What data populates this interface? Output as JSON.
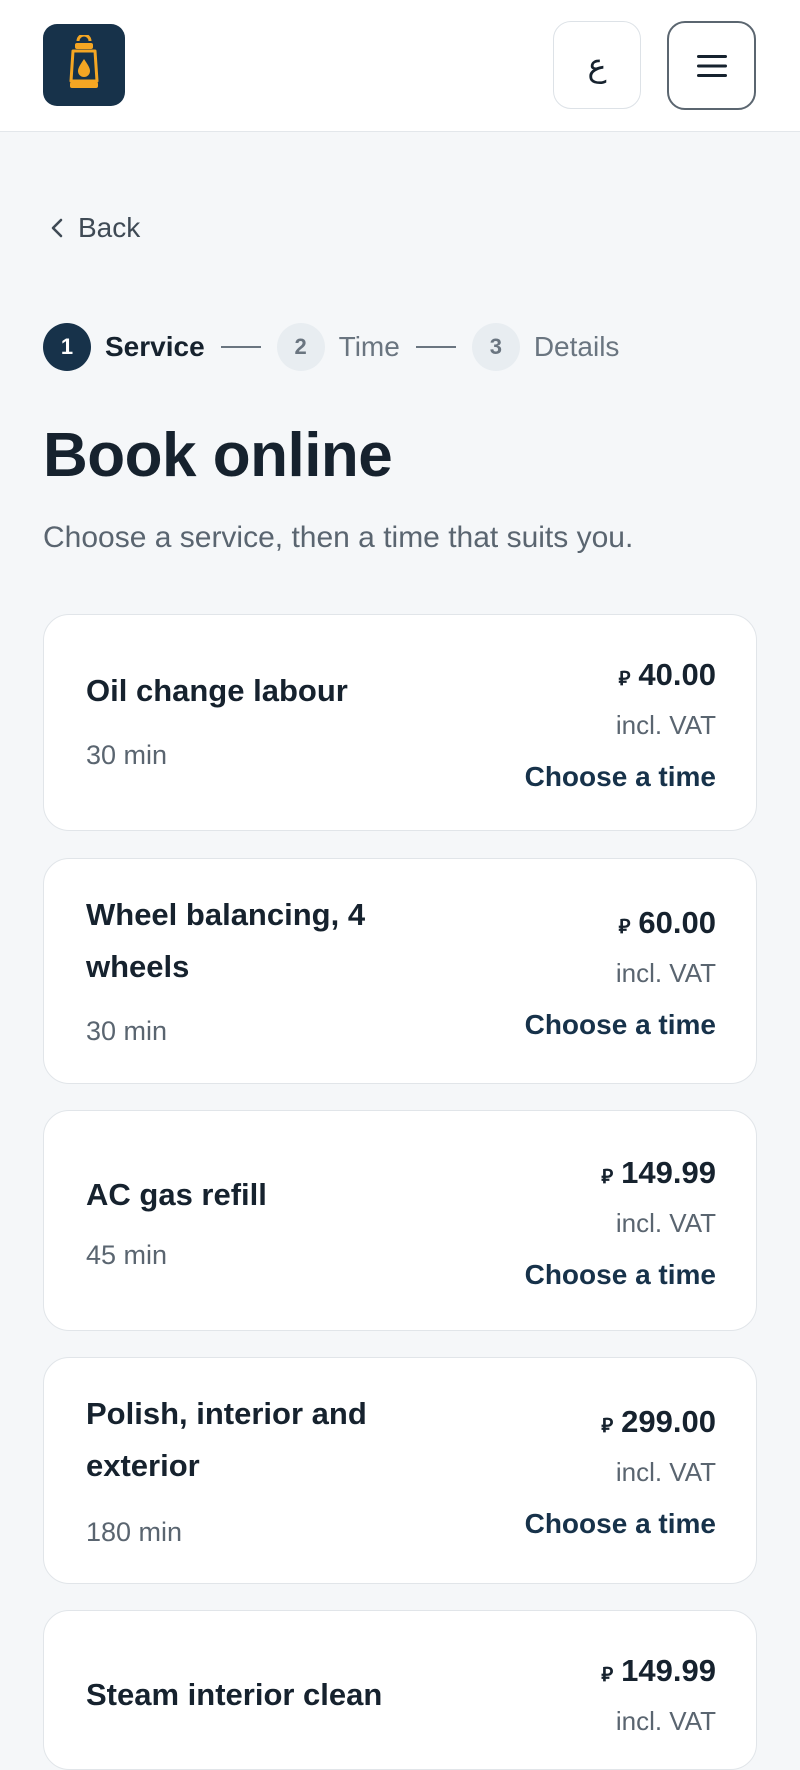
{
  "header": {
    "logo_icon": "lantern-icon",
    "language_toggle": "ع",
    "menu_icon": "hamburger-icon"
  },
  "nav": {
    "back_label": "Back",
    "back_icon": "chevron-left-icon"
  },
  "stepper": {
    "steps": [
      {
        "number": "1",
        "label": "Service",
        "active": true
      },
      {
        "number": "2",
        "label": "Time",
        "active": false
      },
      {
        "number": "3",
        "label": "Details",
        "active": false
      }
    ]
  },
  "main": {
    "title": "Book online",
    "subtitle": "Choose a service, then a time that suits you."
  },
  "services": [
    {
      "name": "Oil change labour",
      "duration": "30 min",
      "currency": "⃁",
      "price": "40.00",
      "vat": "incl. VAT",
      "cta": "Choose a time"
    },
    {
      "name": "Wheel balancing, 4 wheels",
      "duration": "30 min",
      "currency": "⃁",
      "price": "60.00",
      "vat": "incl. VAT",
      "cta": "Choose a time"
    },
    {
      "name": "AC gas refill",
      "duration": "45 min",
      "currency": "⃁",
      "price": "149.99",
      "vat": "incl. VAT",
      "cta": "Choose a time"
    },
    {
      "name": "Polish, interior and exterior",
      "duration": "180 min",
      "currency": "⃁",
      "price": "299.00",
      "vat": "incl. VAT",
      "cta": "Choose a time"
    },
    {
      "name": "Steam interior clean",
      "currency": "⃁",
      "price": "149.99",
      "vat": "incl. VAT"
    }
  ],
  "colors": {
    "brand": "#17324a",
    "accent": "#f5a623",
    "background": "#f5f7f9"
  }
}
